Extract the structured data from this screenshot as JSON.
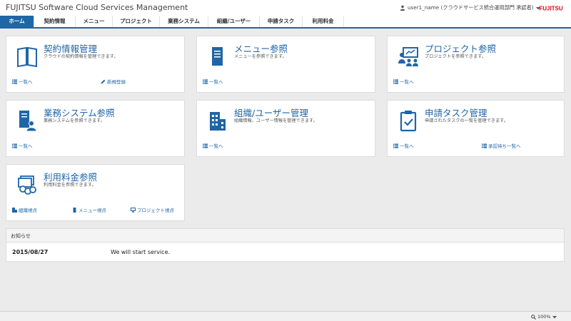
{
  "header": {
    "app_title": "FUJITSU Software Cloud Services Management",
    "user_label": "user1_name (クラウドサービス統合運用部門 承認者)",
    "logo_text": "FUJITSU"
  },
  "nav": {
    "tabs": [
      {
        "label": "ホーム",
        "active": true
      },
      {
        "label": "契約情報"
      },
      {
        "label": "メニュー"
      },
      {
        "label": "プロジェクト"
      },
      {
        "label": "業務システム"
      },
      {
        "label": "組織/ユーザー"
      },
      {
        "label": "申請タスク"
      },
      {
        "label": "利用料金"
      }
    ]
  },
  "cards": [
    {
      "title": "契約情報管理",
      "description": "クラウドの契約情報を管理できます。",
      "icon": "book-info-icon",
      "links": [
        "一覧へ",
        "新規登録"
      ]
    },
    {
      "title": "メニュー参照",
      "description": "メニューを参照できます。",
      "icon": "menu-document-icon",
      "links": [
        "一覧へ"
      ]
    },
    {
      "title": "プロジェクト参照",
      "description": "プロジェクトを参照できます。",
      "icon": "project-presentation-icon",
      "links": [
        "一覧へ"
      ]
    },
    {
      "title": "業務システム参照",
      "description": "業務システムを参照できます。",
      "icon": "system-user-icon",
      "links": [
        "一覧へ"
      ]
    },
    {
      "title": "組織/ユーザー管理",
      "description": "組織情報、ユーザー情報を管理できます。",
      "icon": "building-icon",
      "links": [
        "一覧へ"
      ]
    },
    {
      "title": "申請タスク管理",
      "description": "申請されたタスクの一覧を管理できます。",
      "icon": "clipboard-check-icon",
      "links": [
        "一覧へ",
        "承認待ち一覧へ"
      ]
    },
    {
      "title": "利用料金参照",
      "description": "利用料金を参照できます。",
      "icon": "billing-coins-icon",
      "links": [
        "組織視点",
        "メニュー視点",
        "プロジェクト視点"
      ]
    }
  ],
  "news": {
    "heading": "お知らせ",
    "items": [
      {
        "date": "2015/08/27",
        "text": "We will start service."
      }
    ]
  },
  "statusbar": {
    "zoom": "100%"
  },
  "colors": {
    "accent": "#1f66a7",
    "background": "#ebebeb",
    "brand_red": "#e60012"
  }
}
